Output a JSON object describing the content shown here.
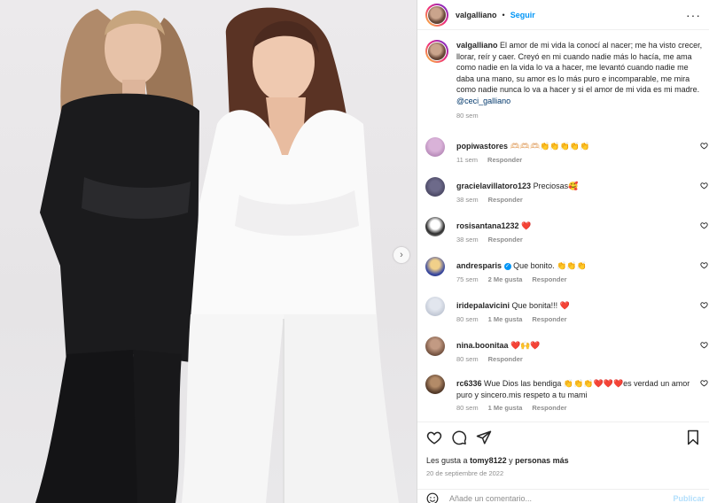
{
  "post": {
    "username": "valgalliano",
    "follow_label": "Seguir",
    "dot": "•",
    "more": "···",
    "caption_text": "El amor de mi vida la conocí al nacer; me ha visto crecer, llorar, reír y caer. Creyó en mi cuando nadie más lo hacía, me ama como nadie en la vida lo va a hacer, me levantó cuando nadie me daba una mano, su amor es lo más puro e incomparable, me mira como nadie nunca lo va a hacer y si el amor de mi vida es mi madre.",
    "caption_mention": "@ceci_galliano",
    "caption_time": "80 sem"
  },
  "comments": [
    {
      "user": "popiwastores",
      "text": "🫶🏻🫶🏻🫶🏻👏👏👏👏👏",
      "time": "11 sem",
      "likes": "",
      "reply": "Responder",
      "avatar": "pic-a"
    },
    {
      "user": "gracielavillatoro123",
      "text": "Preciosas🥰",
      "time": "38 sem",
      "likes": "",
      "reply": "Responder",
      "avatar": "pic-b"
    },
    {
      "user": "rosisantana1232",
      "text": "❤️",
      "time": "38 sem",
      "likes": "",
      "reply": "Responder",
      "avatar": "pic-c"
    },
    {
      "user": "andresparis",
      "text": "Que bonito. 👏👏👏",
      "time": "75 sem",
      "likes": "2 Me gusta",
      "reply": "Responder",
      "avatar": "pic-d",
      "verified": true
    },
    {
      "user": "iridepalavicini",
      "text": "Que bonita!!! ❤️",
      "time": "80 sem",
      "likes": "1 Me gusta",
      "reply": "Responder",
      "avatar": "pic-e"
    },
    {
      "user": "nina.boonitaa",
      "text": "❤️🙌❤️",
      "time": "80 sem",
      "likes": "",
      "reply": "Responder",
      "avatar": "pic-f"
    },
    {
      "user": "rc6336",
      "text": "Wue Dios las bendiga 👏👏👏❤️❤️❤️es verdad un amor puro y sincero.mis respeto a tu mami",
      "time": "80 sem",
      "likes": "1 Me gusta",
      "reply": "Responder",
      "avatar": "pic-g"
    }
  ],
  "actions": {
    "likes_prefix": "Les gusta a",
    "likes_user": "tomy8122",
    "likes_mid": "y",
    "likes_others": "personas más",
    "date": "20 de septiembre de 2022",
    "comment_placeholder": "Añade un comentario...",
    "post_label": "Publicar"
  },
  "icons": {
    "heart": "heart-icon",
    "comment": "comment-icon",
    "share": "share-icon",
    "bookmark": "bookmark-icon",
    "emoji": "emoji-icon",
    "next": "chevron-right-icon"
  }
}
